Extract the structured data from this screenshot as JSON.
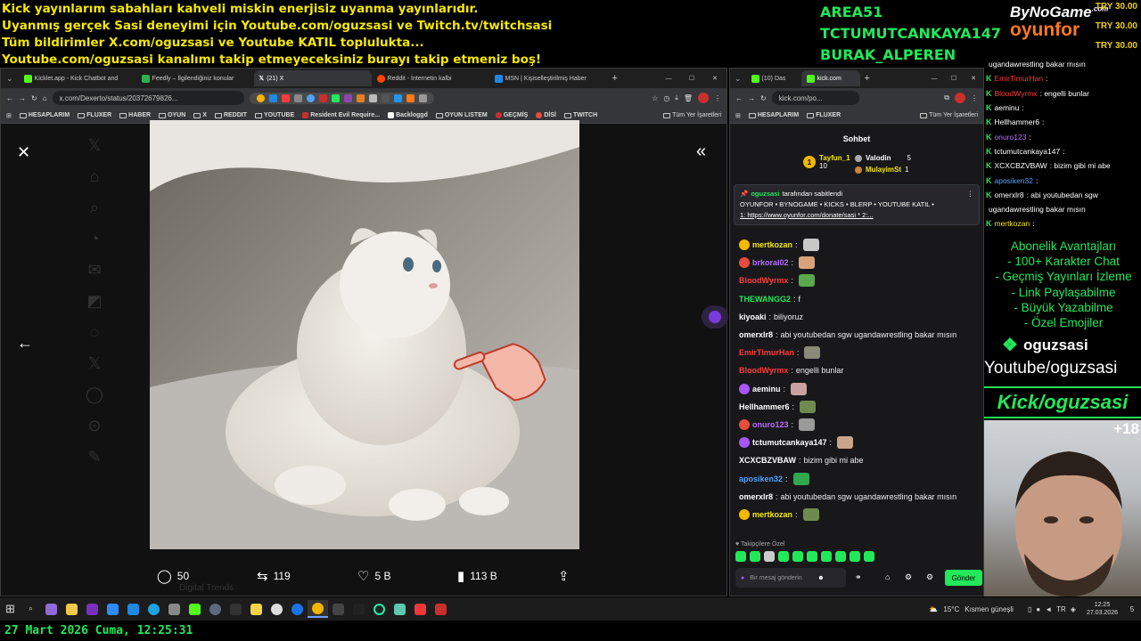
{
  "ticker": [
    "Kick yayınlarım sabahları kahveli miskin enerjisiz uyanma yayınlarıdır.",
    "Uyanmış gerçek Sasi deneyimi için Youtube.com/oguzsasi ve Twitch.tv/twitchsasi",
    "Tüm bildirimler X.com/oguzsasi ve Youtube KATIL toplulukta...",
    "Youtube.com/oguzsasi kanalımı takip etmeyeceksiniz burayı takip etmeniz boş!"
  ],
  "sponsors": [
    "AREA51",
    "TCTUMUTCANKAYA147",
    "BURAK_ALPEREN"
  ],
  "logo": {
    "top": "ByNoGame",
    "small": ".com",
    "bottom": "oyunfor"
  },
  "prices": [
    "TRY 30.00",
    "TRY 30.00",
    "TRY 30.00"
  ],
  "left_browser": {
    "tabs": [
      {
        "label": "Kicklet.app - Kick Chatbot and",
        "color": "#53fc18"
      },
      {
        "label": "Feedly – İlgilendiğiniz konular",
        "color": "#2bb24c"
      },
      {
        "label": "(21) X",
        "color": "#ffffff"
      },
      {
        "label": "Reddit - İnternetin kalbi",
        "color": "#ff4500"
      },
      {
        "label": "MSN | Kişiselleştirilmiş Haber",
        "color": "#1e88e5"
      }
    ],
    "url": "x.com/Dexerto/status/20372679826...",
    "bookmarks": [
      "HESAPLARIM",
      "FLUXER",
      "HABER",
      "OYUN",
      "X",
      "REDDIT",
      "YOUTUBE",
      "Resident Evil Require...",
      "Backloggd",
      "OYUN LISTEM",
      "GEÇMİŞ",
      "DİSİ",
      "TWITCH"
    ],
    "all_bookmarks": "Tüm Yer İşaretleri",
    "stats": {
      "replies": "50",
      "reposts": "119",
      "likes": "5 B",
      "views": "113 B"
    },
    "behind": "Digital Trends"
  },
  "right_browser": {
    "tabs": [
      {
        "label": "(10) Das",
        "color": "#53fc18"
      },
      {
        "label": "kick.com",
        "color": "#53fc18"
      }
    ],
    "url": "kick.com/po...",
    "bookmarks": [
      "HESAPLARIM",
      "FLUXER"
    ],
    "all_bookmarks": "Tüm Yer İşaretleri",
    "chat_title": "Sohbet",
    "leaders": [
      {
        "rank": "1",
        "name": "Tayfun_1",
        "val": "10"
      },
      {
        "rank": "",
        "name": "Valodin",
        "val": "5"
      },
      {
        "rank": "",
        "name": "MulayimSt",
        "val": "1"
      }
    ],
    "pinned": {
      "by": "oguzsasi",
      "by_suffix": "tarafından sabitlendi",
      "line1": "OYUNFOR • BYNOGAME • KICKS • BLERP • YOUTUBE KATIL •",
      "line2": "1: https://www.oyunfor.com/donate/sasi * 2:..."
    },
    "messages": [
      {
        "user": "mertkozan",
        "color": "#f5e800",
        "text": "",
        "emote": "#c8c8c8"
      },
      {
        "user": "brkoral02",
        "color": "#b96cff",
        "text": "",
        "emote": "#d9a37a"
      },
      {
        "user": "BloodWyrmx",
        "color": "#ff3b3b",
        "text": "",
        "emote": "#59a84b"
      },
      {
        "user": "THEWANGG2",
        "color": "#22e85a",
        "text": "f",
        "emote": ""
      },
      {
        "user": "kiyoaki",
        "color": "#ffffff",
        "text": "biliyoruz",
        "emote": ""
      },
      {
        "user": "omerxlr8",
        "color": "#ffffff",
        "text": "abi youtubedan sgw ugandawrestling bakar mısın",
        "emote": ""
      },
      {
        "user": "EmirTimurHan",
        "color": "#ff3b3b",
        "text": "",
        "emote": "#8a8a7a"
      },
      {
        "user": "BloodWyrmx",
        "color": "#ff3b3b",
        "text": "engelli bunlar",
        "emote": ""
      },
      {
        "user": "aeminu",
        "color": "#ffffff",
        "text": "",
        "emote": "#c9a1a1"
      },
      {
        "user": "Hellhammer6",
        "color": "#ffffff",
        "text": "",
        "emote": "#6f8a4f"
      },
      {
        "user": "onuro123",
        "color": "#b96cff",
        "text": "",
        "emote": "#9a9a9a"
      },
      {
        "user": "tctumutcankaya147",
        "color": "#ffffff",
        "text": "",
        "emote": "#c9a38a"
      },
      {
        "user": "XCXCBZVBAW",
        "color": "#ffffff",
        "text": "bizim gibi mi abe",
        "emote": ""
      },
      {
        "user": "aposiken32",
        "color": "#4fa3ff",
        "text": "",
        "emote": "#2fa84f"
      },
      {
        "user": "omerxlr8",
        "color": "#ffffff",
        "text": "abi youtubedan sgw ugandawrestling bakar mısın",
        "emote": ""
      },
      {
        "user": "mertkozan",
        "color": "#f5e800",
        "text": "",
        "emote": "#6f8a4f"
      }
    ],
    "followers_only": "Takipçilere Özel",
    "input_placeholder": "Bir mesaj gönderin",
    "send": "Gönder"
  },
  "overlay_chat": [
    {
      "user": "",
      "color": "#ffffff",
      "text": "ugandawrestling bakar mısın"
    },
    {
      "user": "EmirTimurHan",
      "color": "#ff3b3b",
      "text": ":"
    },
    {
      "user": "BloodWyrmx",
      "color": "#ff3b3b",
      "text": ": engelli bunlar"
    },
    {
      "user": "aeminu",
      "color": "#ffffff",
      "text": ":"
    },
    {
      "user": "Hellhammer6",
      "color": "#ffffff",
      "text": ":"
    },
    {
      "user": "onuro123",
      "color": "#b96cff",
      "text": ":"
    },
    {
      "user": "tctumutcankaya147",
      "color": "#ffffff",
      "text": ":"
    },
    {
      "user": "XCXCBZVBAW",
      "color": "#ffffff",
      "text": ": bizim gibi mi abe"
    },
    {
      "user": "aposiken32",
      "color": "#4fa3ff",
      "text": ":"
    },
    {
      "user": "omerxlr8",
      "color": "#ffffff",
      "text": ": abi youtubedan sgw"
    },
    {
      "user": "",
      "color": "#ffffff",
      "text": "ugandawrestling bakar mısın"
    },
    {
      "user": "mertkozan",
      "color": "#f5e800",
      "text": ":"
    }
  ],
  "perks": [
    "Abonelik Avantajları",
    "- 100+ Karakter Chat",
    "- Geçmiş Yayınları İzleme",
    "- Link Paylaşabilme",
    "- Büyük Yazabilme",
    "- Özel Emojiler"
  ],
  "handle": "oguzsasi",
  "youtube": "Youtube/oguzsasi",
  "kick": "Kick/oguzsasi",
  "plus": "+18",
  "taskbar": {
    "weather": "15°C",
    "weather_text": "Kısmen güneşli",
    "time": "12:25",
    "date": "27.03.2026",
    "notif": "5"
  },
  "footer_clock": "27 Mart 2026 Cuma, 12:25:31"
}
